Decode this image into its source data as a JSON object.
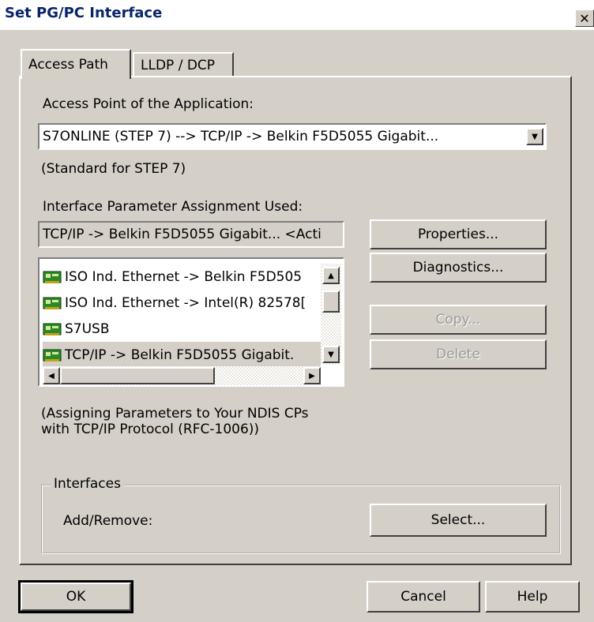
{
  "window": {
    "title": "Set PG/PC Interface",
    "close_glyph": "✕"
  },
  "tabs": [
    {
      "label": "Access Path",
      "active": true
    },
    {
      "label": "LLDP / DCP",
      "active": false
    }
  ],
  "access_point": {
    "label": "Access Point of the Application:",
    "value": "S7ONLINE      (STEP 7)      --> TCP/IP -> Belkin F5D5055 Gigabit...",
    "note": "(Standard for STEP 7)"
  },
  "interface_param": {
    "label": "Interface Parameter Assignment Used:",
    "value": "TCP/IP -> Belkin F5D5055 Gigabit...  <Acti",
    "items": [
      {
        "label": "ISO Ind. Ethernet -> Belkin F5D505",
        "icon": "network-card-icon",
        "selected": false
      },
      {
        "label": "ISO Ind. Ethernet -> Intel(R) 82578[",
        "icon": "network-card-icon",
        "selected": false
      },
      {
        "label": "S7USB",
        "icon": "network-card-icon",
        "selected": false
      },
      {
        "label": "TCP/IP -> Belkin F5D5055 Gigabit.",
        "icon": "network-card-icon",
        "selected": true
      }
    ],
    "description_line1": "(Assigning Parameters to Your NDIS CPs",
    "description_line2": "with TCP/IP Protocol (RFC-1006))"
  },
  "side_buttons": {
    "properties": "Properties...",
    "diagnostics": "Diagnostics...",
    "copy": "Copy...",
    "delete": "Delete"
  },
  "interfaces_group": {
    "legend": "Interfaces",
    "add_remove_label": "Add/Remove:",
    "select_button": "Select..."
  },
  "footer": {
    "ok": "OK",
    "cancel": "Cancel",
    "help": "Help"
  },
  "colors": {
    "dialog_face": "#d4d0c8",
    "title_text": "#0a246a",
    "disabled_text": "#9a9a9a"
  }
}
